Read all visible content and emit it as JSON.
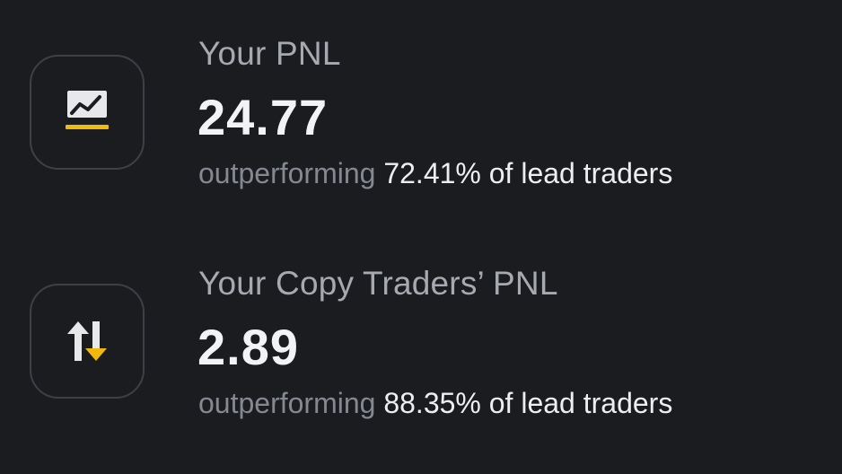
{
  "colors": {
    "background": "#1b1c20",
    "accent": "#f0b90b",
    "icon_foreground": "#e6e8ea",
    "muted_text": "#858891",
    "label_text": "#a7a9b0"
  },
  "stats": [
    {
      "icon": "chart-line-icon",
      "label": "Your PNL",
      "value": "24.77",
      "sub_prefix": "outperforming",
      "sub_suffix": "72.41% of lead traders"
    },
    {
      "icon": "swap-arrows-icon",
      "label": "Your Copy Traders’ PNL",
      "value": "2.89",
      "sub_prefix": "outperforming",
      "sub_suffix": "88.35% of lead traders"
    }
  ]
}
